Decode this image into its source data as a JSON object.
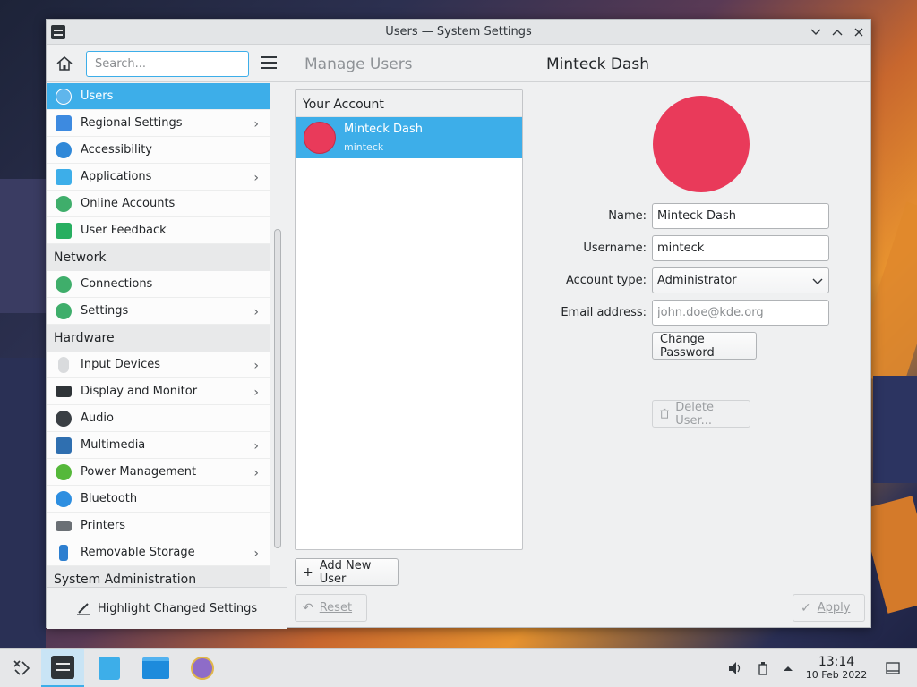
{
  "window": {
    "title": "Users — System Settings"
  },
  "header": {
    "search_placeholder": "Search...",
    "breadcrumb_parent": "Manage Users",
    "page_title": "Minteck Dash"
  },
  "sidebar": {
    "items": [
      {
        "label": "Users",
        "icon": "users-icon",
        "selected": true,
        "has_submenu": false
      },
      {
        "label": "Regional Settings",
        "icon": "regional-settings-icon",
        "has_submenu": true
      },
      {
        "label": "Accessibility",
        "icon": "accessibility-icon",
        "has_submenu": false
      },
      {
        "label": "Applications",
        "icon": "applications-icon",
        "has_submenu": true
      },
      {
        "label": "Online Accounts",
        "icon": "online-accounts-icon",
        "has_submenu": false
      },
      {
        "label": "User Feedback",
        "icon": "user-feedback-icon",
        "has_submenu": false
      }
    ],
    "network_title": "Network",
    "network_items": [
      {
        "label": "Connections",
        "icon": "connections-icon",
        "has_submenu": false
      },
      {
        "label": "Settings",
        "icon": "network-settings-icon",
        "has_submenu": true
      }
    ],
    "hardware_title": "Hardware",
    "hardware_items": [
      {
        "label": "Input Devices",
        "icon": "input-devices-icon",
        "has_submenu": true
      },
      {
        "label": "Display and Monitor",
        "icon": "display-monitor-icon",
        "has_submenu": true
      },
      {
        "label": "Audio",
        "icon": "audio-icon",
        "has_submenu": false
      },
      {
        "label": "Multimedia",
        "icon": "multimedia-icon",
        "has_submenu": true
      },
      {
        "label": "Power Management",
        "icon": "power-management-icon",
        "has_submenu": true
      },
      {
        "label": "Bluetooth",
        "icon": "bluetooth-icon",
        "has_submenu": false
      },
      {
        "label": "Printers",
        "icon": "printers-icon",
        "has_submenu": false
      },
      {
        "label": "Removable Storage",
        "icon": "removable-storage-icon",
        "has_submenu": true
      }
    ],
    "sysadmin_title": "System Administration",
    "highlight_label": "Highlight Changed Settings"
  },
  "users_list": {
    "section_title": "Your Account",
    "users": [
      {
        "name": "Minteck Dash",
        "login": "minteck",
        "selected": true
      }
    ],
    "add_user_label": "Add New User"
  },
  "details": {
    "name_label": "Name:",
    "name_value": "Minteck Dash",
    "username_label": "Username:",
    "username_value": "minteck",
    "account_type_label": "Account type:",
    "account_type_value": "Administrator",
    "email_label": "Email address:",
    "email_placeholder": "john.doe@kde.org",
    "change_password_label": "Change Password",
    "delete_user_label": "Delete User...",
    "avatar_color": "#e93a5a"
  },
  "footer": {
    "reset_label": "Reset",
    "apply_label": "Apply"
  },
  "taskbar": {
    "time": "13:14",
    "date": "10 Feb 2022",
    "apps": [
      "app-launcher-icon",
      "system-settings-icon",
      "discover-icon",
      "dolphin-icon",
      "kdeconnect-icon"
    ]
  },
  "colors": {
    "accent": "#3daee9",
    "avatar": "#e93a5a"
  }
}
